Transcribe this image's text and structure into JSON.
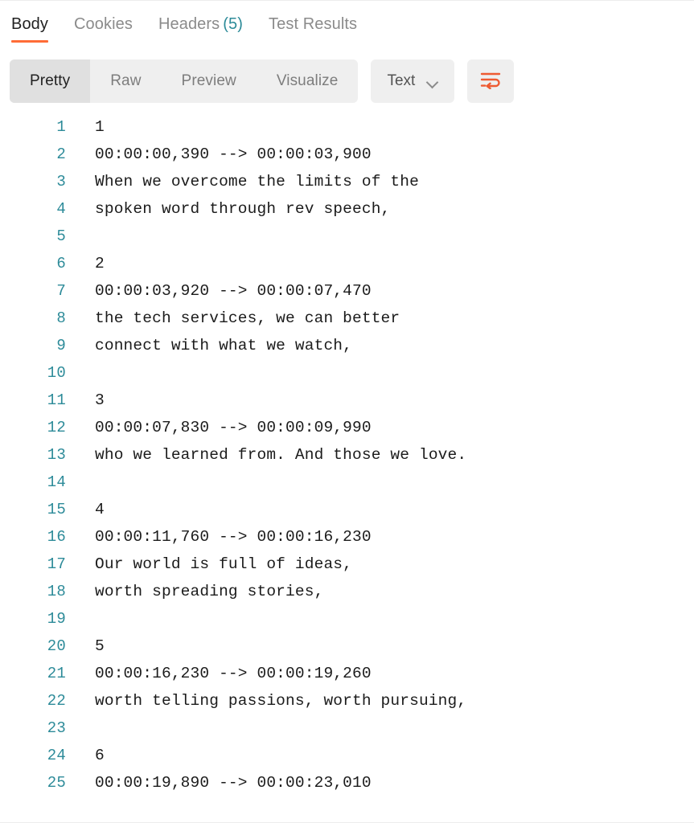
{
  "response_tabs": [
    {
      "label": "Body",
      "count": null,
      "active": true
    },
    {
      "label": "Cookies",
      "count": null,
      "active": false
    },
    {
      "label": "Headers",
      "count": "(5)",
      "active": false
    },
    {
      "label": "Test Results",
      "count": null,
      "active": false
    }
  ],
  "toolbar": {
    "view_modes": [
      {
        "label": "Pretty",
        "active": true
      },
      {
        "label": "Raw",
        "active": false
      },
      {
        "label": "Preview",
        "active": false
      },
      {
        "label": "Visualize",
        "active": false
      }
    ],
    "format_dropdown": {
      "selected": "Text",
      "icon": "chevron-down-icon"
    },
    "wrap_button": {
      "icon": "word-wrap-icon",
      "color": "#ee5a32"
    }
  },
  "colors": {
    "accent": "#ff6c37",
    "line_number": "#2d8b99",
    "code_text": "#1b1b1b",
    "toolbar_bg": "#efefef",
    "toolbar_active_bg": "#e0e0e0",
    "tab_inactive": "#8b8b8b",
    "tab_active": "#212121"
  },
  "code": {
    "language": "Text",
    "lines": [
      {
        "n": "1",
        "text": "1"
      },
      {
        "n": "2",
        "text": "00:00:00,390 --> 00:00:03,900"
      },
      {
        "n": "3",
        "text": "When we overcome the limits of the"
      },
      {
        "n": "4",
        "text": "spoken word through rev speech,"
      },
      {
        "n": "5",
        "text": ""
      },
      {
        "n": "6",
        "text": "2"
      },
      {
        "n": "7",
        "text": "00:00:03,920 --> 00:00:07,470"
      },
      {
        "n": "8",
        "text": "the tech services, we can better"
      },
      {
        "n": "9",
        "text": "connect with what we watch,"
      },
      {
        "n": "10",
        "text": ""
      },
      {
        "n": "11",
        "text": "3"
      },
      {
        "n": "12",
        "text": "00:00:07,830 --> 00:00:09,990"
      },
      {
        "n": "13",
        "text": "who we learned from. And those we love."
      },
      {
        "n": "14",
        "text": ""
      },
      {
        "n": "15",
        "text": "4"
      },
      {
        "n": "16",
        "text": "00:00:11,760 --> 00:00:16,230"
      },
      {
        "n": "17",
        "text": "Our world is full of ideas,"
      },
      {
        "n": "18",
        "text": "worth spreading stories,"
      },
      {
        "n": "19",
        "text": ""
      },
      {
        "n": "20",
        "text": "5"
      },
      {
        "n": "21",
        "text": "00:00:16,230 --> 00:00:19,260"
      },
      {
        "n": "22",
        "text": "worth telling passions, worth pursuing,"
      },
      {
        "n": "23",
        "text": ""
      },
      {
        "n": "24",
        "text": "6"
      },
      {
        "n": "25",
        "text": "00:00:19,890 --> 00:00:23,010"
      }
    ]
  }
}
